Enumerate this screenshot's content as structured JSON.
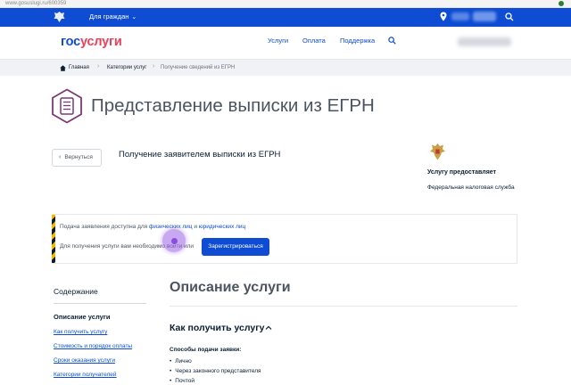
{
  "browser": {
    "url": "www.gosuslugi.ru/600359"
  },
  "topbar": {
    "audience_label": "Для граждан"
  },
  "header": {
    "logo_gos": "гос",
    "logo_uslugi": "услуги",
    "nav": {
      "services": "Услуги",
      "payment": "Оплата",
      "support": "Поддержка"
    }
  },
  "breadcrumbs": {
    "home": "Главная",
    "category": "Категории услуг",
    "current": "Получение сведений из ЕГРН"
  },
  "page": {
    "title": "Представление выписки из ЕГРН",
    "back_label": "Вернуться",
    "subtitle": "Получение заявителем выписки из ЕГРН"
  },
  "provider": {
    "label": "Услугу предоставляет",
    "name": "Федеральная налоговая служба"
  },
  "notice": {
    "line1_prefix": "Подача заявления доступна для",
    "line1_link1": "физических лиц",
    "line1_and": "и",
    "line1_link2": "юридических лиц",
    "line2": "Для получения услуги вам необходимо войти или",
    "register_label": "Зарегистрироваться"
  },
  "toc": {
    "title": "Содержание",
    "active": "Описание услуги",
    "items": [
      "Как получить услугу",
      "Стоимость и порядок оплаты",
      "Сроки оказания услуги",
      "Категории получателей"
    ]
  },
  "description": {
    "title": "Описание услуги",
    "how_title": "Как получить услугу",
    "methods_label": "Способы подачи заявки:",
    "methods": [
      "Лично",
      "Через законного представителя",
      "Почтой"
    ]
  },
  "colors": {
    "brand_blue": "#0d4cd3",
    "brand_red": "#ee3f58",
    "warning_yellow": "#f5b800"
  }
}
